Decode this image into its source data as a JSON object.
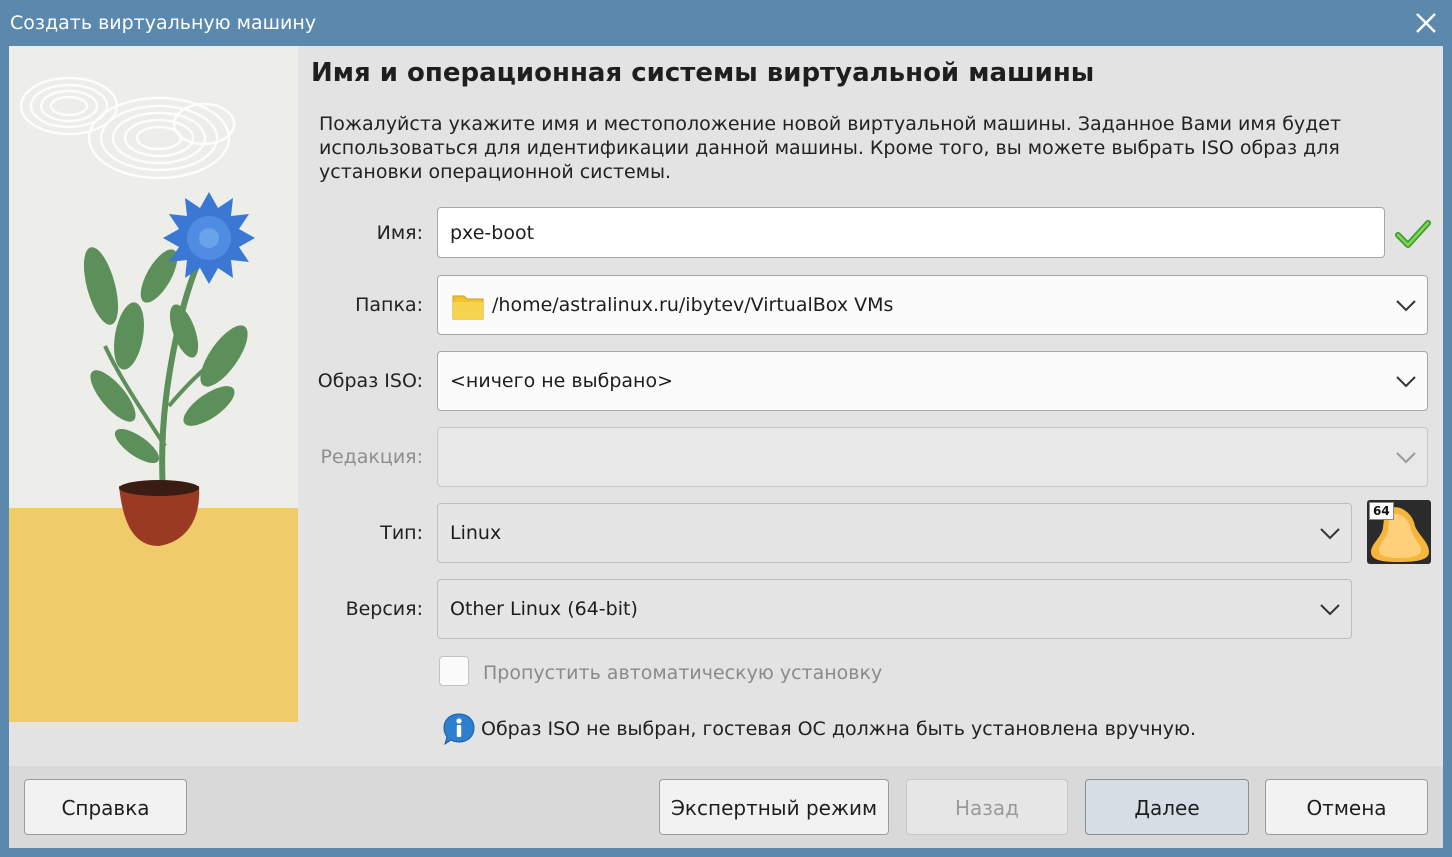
{
  "window": {
    "title": "Создать виртуальную машину"
  },
  "page": {
    "heading": "Имя и операционная системы виртуальной машины",
    "description": "Пожалуйста укажите имя и местоположение новой виртуальной машины. Заданное Вами имя будет использоваться для идентификации данной машины. Кроме того, вы можете выбрать ISO образ для установки операционной системы."
  },
  "form": {
    "name": {
      "label": "Имя:",
      "value": "pxe-boot"
    },
    "folder": {
      "label": "Папка:",
      "value": "/home/astralinux.ru/ibytev/VirtualBox VMs"
    },
    "iso": {
      "label": "Образ ISO:",
      "value": "<ничего не выбрано>"
    },
    "edition": {
      "label": "Редакция:",
      "value": ""
    },
    "type": {
      "label": "Тип:",
      "value": "Linux"
    },
    "version": {
      "label": "Версия:",
      "value": "Other Linux (64-bit)"
    },
    "skip_unattended": {
      "label": "Пропустить автоматическую установку",
      "checked": false
    },
    "os_badge": "64"
  },
  "info": {
    "text": "Образ ISO не выбран, гостевая ОС должна быть установлена вручную."
  },
  "buttons": {
    "help": "Справка",
    "expert": "Экспертный режим",
    "back": "Назад",
    "next": "Далее",
    "cancel": "Отмена"
  },
  "colors": {
    "titlebar": "#5b88ad",
    "content_bg": "#e3e3e3",
    "illustration_yellow": "#f0cb6a",
    "flower_blue": "#3a78d4",
    "leaf_green": "#5d8f5a",
    "pot_red": "#9b3a23"
  },
  "icons": {
    "close": "close-icon",
    "folder": "folder-icon",
    "chevron": "chevron-down-icon",
    "valid": "checkmark-icon",
    "info": "info-icon",
    "os": "linux-os-icon"
  }
}
